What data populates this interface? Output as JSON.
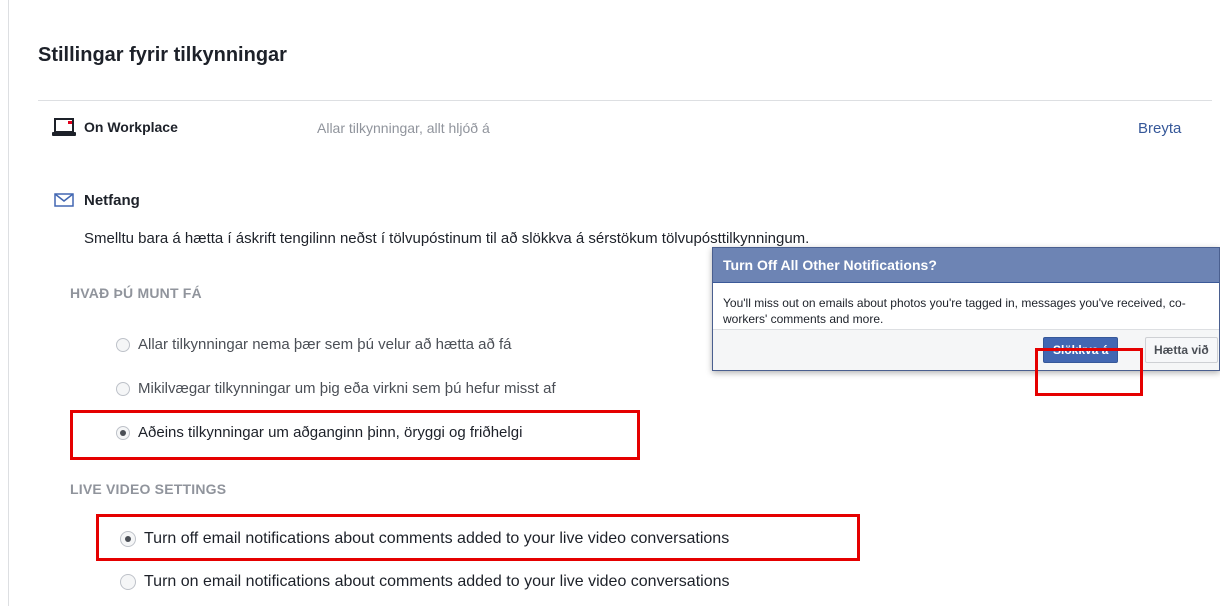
{
  "page": {
    "title": "Stillingar fyrir tilkynningar"
  },
  "workplace": {
    "label": "On Workplace",
    "summary": "Allar tilkynningar, allt hljóð á",
    "edit_link": "Breyta",
    "icon": "laptop-icon"
  },
  "email": {
    "label": "Netfang",
    "icon": "envelope-icon",
    "description": "Smelltu bara á hætta í áskrift tengilinn neðst í tölvupóstinum til að slökkva á sérstökum tölvupósttilkynningum.",
    "section_heading": "HVAÐ ÞÚ MUNT FÁ",
    "options": [
      {
        "label": "Allar tilkynningar nema þær sem þú velur að hætta að fá",
        "checked": false
      },
      {
        "label": "Mikilvægar tilkynningar um þig eða virkni sem þú hefur misst af",
        "checked": false
      },
      {
        "label": "Aðeins tilkynningar um aðganginn þinn, öryggi og friðhelgi",
        "checked": true
      }
    ]
  },
  "live_video": {
    "section_heading": "LIVE VIDEO SETTINGS",
    "options": [
      {
        "label": "Turn off email notifications about comments added to your live video conversations",
        "checked": true
      },
      {
        "label": "Turn on email notifications about comments added to your live video conversations",
        "checked": false
      }
    ]
  },
  "dialog": {
    "title": "Turn Off All Other Notifications?",
    "body": "You'll miss out on emails about photos you're tagged in, messages you've received, co-workers' comments and more.",
    "confirm_label": "Slökkva á",
    "cancel_label": "Hætta við"
  },
  "colors": {
    "highlight": "#e50000",
    "primary_button": "#4267b2",
    "dialog_header": "#6d84b4",
    "link": "#365899"
  }
}
